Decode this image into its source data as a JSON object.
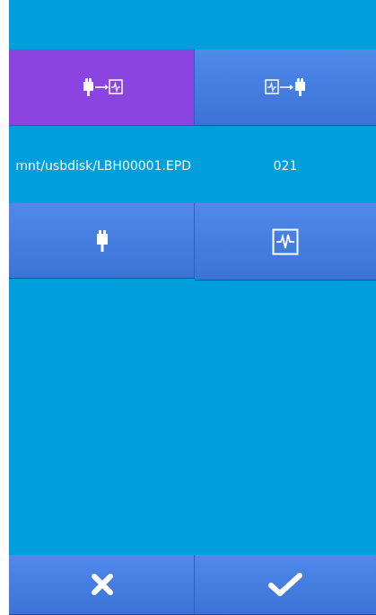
{
  "transfer_mode": {
    "usb_to_machine": {
      "icon": "usb-to-machine-icon",
      "selected": true
    },
    "machine_to_usb": {
      "icon": "machine-to-usb-icon",
      "selected": false
    }
  },
  "file_info": {
    "source_path": "mnt/usbdisk/LBH00001.EPD",
    "target_number": "021"
  },
  "browse": {
    "usb_icon": "usb-drive-icon",
    "machine_icon": "machine-memory-icon"
  },
  "footer": {
    "cancel_icon": "close-icon",
    "confirm_icon": "checkmark-icon"
  },
  "colors": {
    "background": "#009fdb",
    "button": "#4479e0",
    "selected": "#8a44e0",
    "icon": "#ffffff"
  }
}
